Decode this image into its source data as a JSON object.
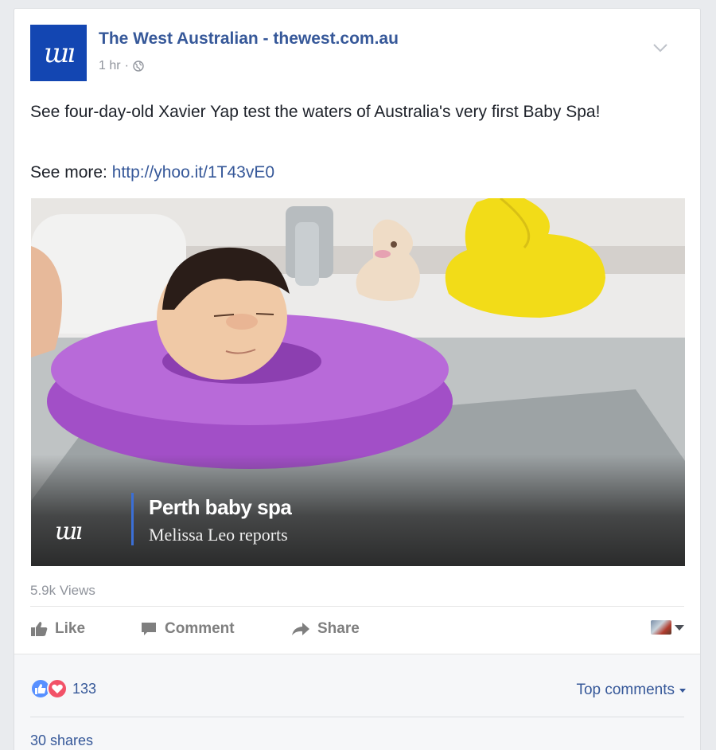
{
  "post": {
    "page_name": "The West Australian - thewest.com.au",
    "logo_text": "ɯı",
    "time": "1 hr",
    "dot": "·",
    "audience_icon": "globe-icon",
    "text": "See four-day-old Xavier Yap test the waters of Australia's very first Baby Spa!",
    "see_more_label": "See more: ",
    "link": "http://yhoo.it/1T43vE0"
  },
  "video": {
    "overlay_logo": "ɯı",
    "title": "Perth baby spa",
    "subtitle": "Melissa Leo reports",
    "views": "5.9k Views"
  },
  "actions": {
    "like": "Like",
    "comment": "Comment",
    "share": "Share"
  },
  "footer": {
    "reaction_count": "133",
    "top_comments": "Top comments",
    "shares": "30 shares"
  },
  "colors": {
    "brand_blue": "#1346b2",
    "link_blue": "#365899",
    "like_blue": "#5890ff",
    "love_red": "#f25268",
    "ring_purple": "#a24fc7"
  }
}
